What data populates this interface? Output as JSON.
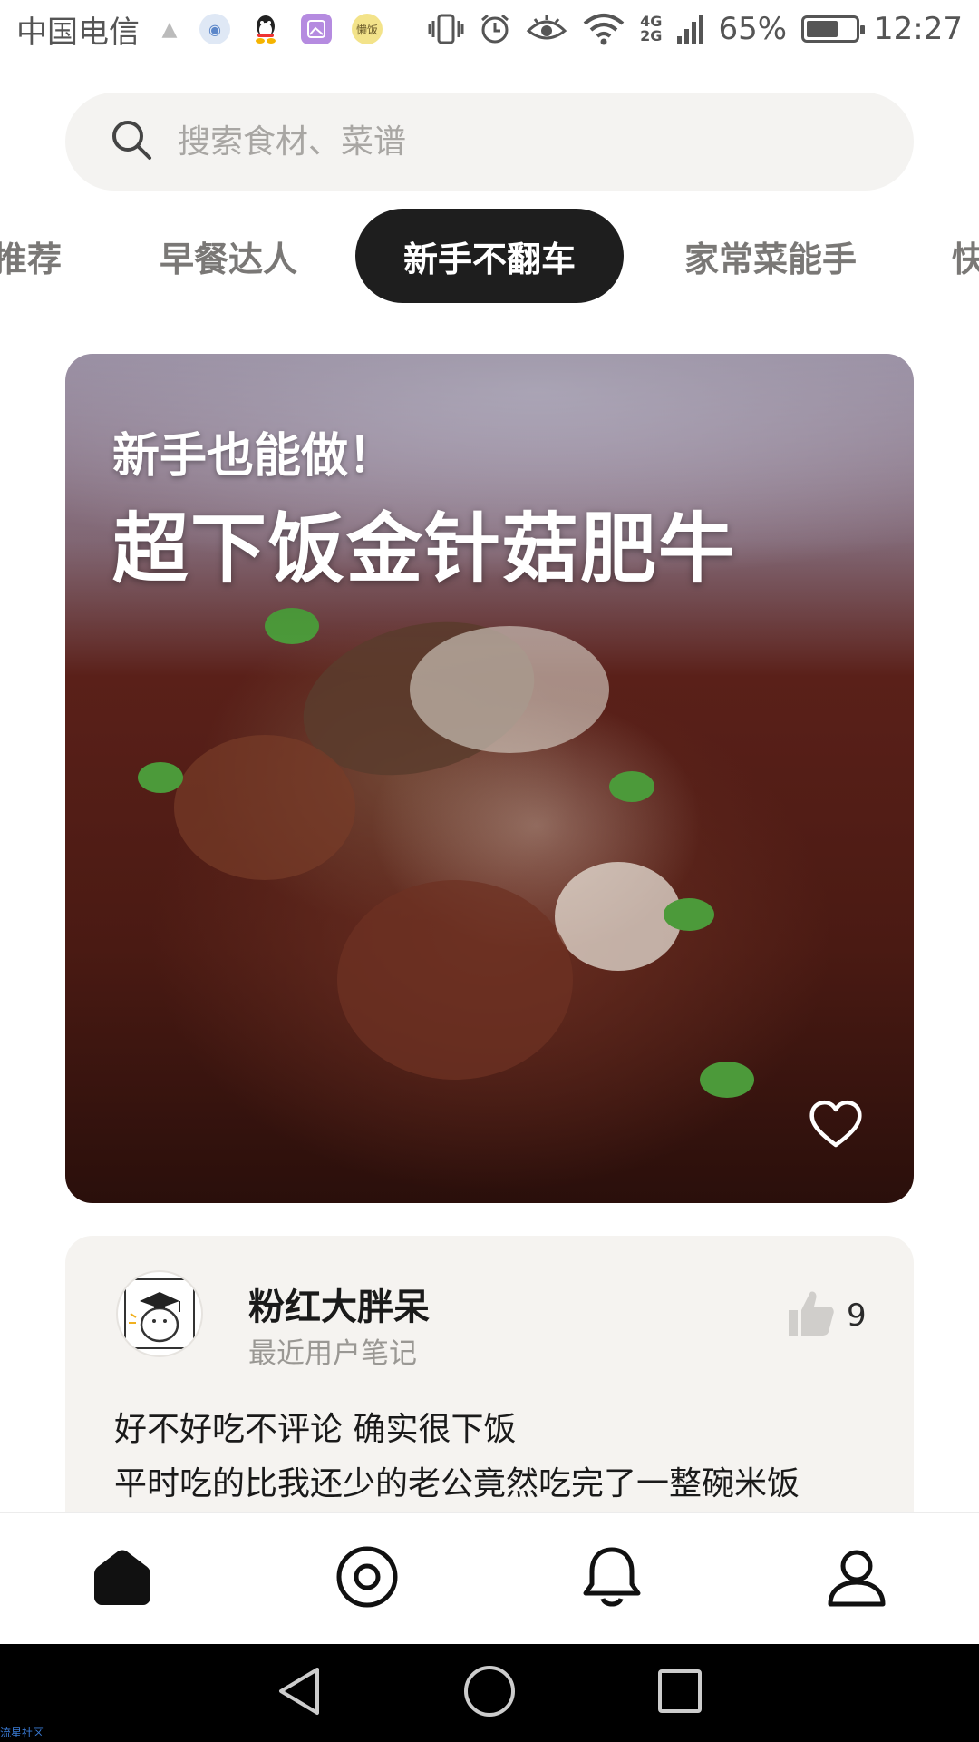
{
  "status_bar": {
    "carrier": "中国电信",
    "battery_percent": "65%",
    "battery_level": 0.65,
    "time": "12:27",
    "network_top": "4G",
    "network_bottom": "2G",
    "notification_app_label": "懒饭"
  },
  "search": {
    "placeholder": "搜索食材、菜谱"
  },
  "tabs": [
    {
      "label": "推荐",
      "active": false
    },
    {
      "label": "早餐达人",
      "active": false
    },
    {
      "label": "新手不翻车",
      "active": true
    },
    {
      "label": "家常菜能手",
      "active": false
    },
    {
      "label": "快",
      "active": false
    }
  ],
  "hero": {
    "subtitle": "新手也能做！",
    "title": "超下饭金针菇肥牛",
    "favorite_icon": "heart-outline-icon"
  },
  "note": {
    "user_name": "粉红大胖呆",
    "user_caption": "最近用户笔记",
    "like_count": "9",
    "lines": [
      "好不好吃不评论 确实很下饭",
      "平时吃的比我还少的老公竟然吃完了一整碗米饭"
    ]
  },
  "bottom_nav": [
    {
      "icon": "home-icon",
      "active": true
    },
    {
      "icon": "discover-icon",
      "active": false
    },
    {
      "icon": "bell-icon",
      "active": false
    },
    {
      "icon": "profile-icon",
      "active": false
    }
  ],
  "system_nav": [
    "back-icon",
    "home-circle-icon",
    "recents-icon"
  ],
  "watermark": "流星社区",
  "colors": {
    "active_tab_bg": "#1e1e1e",
    "search_bg": "#f4f3f1",
    "card_bg": "#f5f3f0",
    "muted_text": "#9a9894"
  }
}
